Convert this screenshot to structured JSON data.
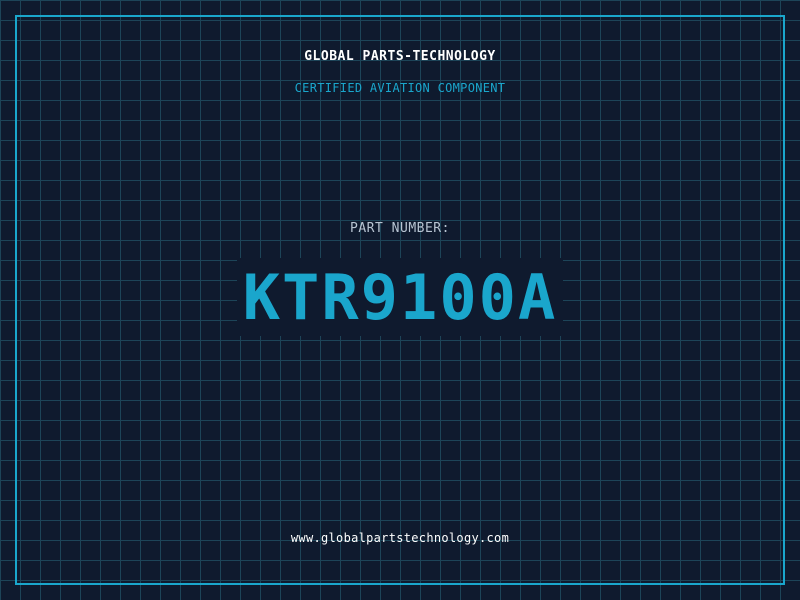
{
  "header": {
    "company": "GLOBAL PARTS-TECHNOLOGY",
    "tagline": "CERTIFIED AVIATION COMPONENT"
  },
  "main": {
    "label": "PART NUMBER:",
    "part_number": "KTR9100A"
  },
  "footer": {
    "website": "www.globalpartstechnology.com"
  },
  "colors": {
    "background": "#0f1a2e",
    "grid": "#1d4458",
    "accent": "#1aa6cc",
    "text": "#ffffff",
    "label": "#b8c4d2"
  }
}
